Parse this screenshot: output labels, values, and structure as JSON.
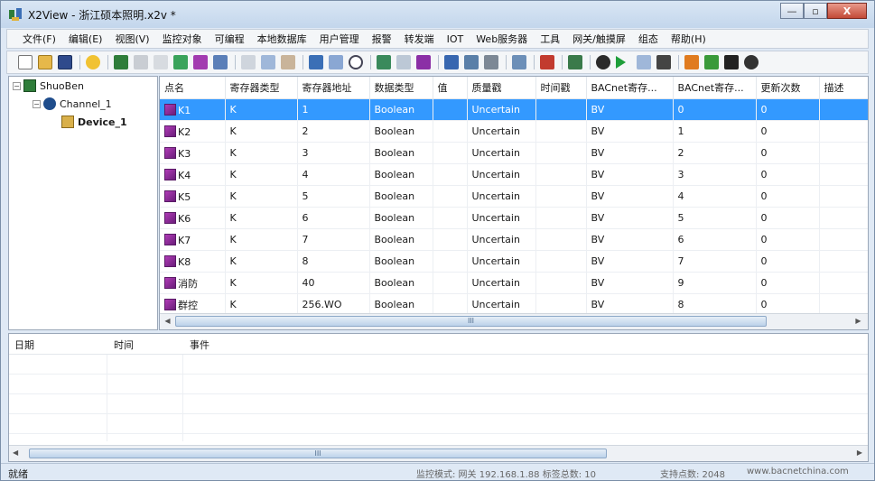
{
  "window": {
    "title": "X2View - 浙江硕本照明.x2v *",
    "min_label": "—",
    "max_label": "▫",
    "close_label": "X"
  },
  "menu": [
    "文件(F)",
    "编辑(E)",
    "视图(V)",
    "监控对象",
    "可编程",
    "本地数据库",
    "用户管理",
    "报警",
    "转发端",
    "IOT",
    "Web服务器",
    "工具",
    "网关/触摸屏",
    "组态",
    "帮助(H)"
  ],
  "tree": {
    "root": "ShuoBen",
    "channel": "Channel_1",
    "device": "Device_1"
  },
  "grid": {
    "columns": [
      "点名",
      "寄存器类型",
      "寄存器地址",
      "数据类型",
      "值",
      "质量戳",
      "时间戳",
      "BACnet寄存...",
      "BACnet寄存...",
      "更新次数",
      "描述"
    ],
    "rows": [
      {
        "name": "K1",
        "reg_type": "K",
        "reg_addr": "1",
        "data_type": "Boolean",
        "value": "",
        "quality": "Uncertain",
        "timestamp": "",
        "bac_type": "BV",
        "bac_addr": "0",
        "updates": "0",
        "desc": ""
      },
      {
        "name": "K2",
        "reg_type": "K",
        "reg_addr": "2",
        "data_type": "Boolean",
        "value": "",
        "quality": "Uncertain",
        "timestamp": "",
        "bac_type": "BV",
        "bac_addr": "1",
        "updates": "0",
        "desc": ""
      },
      {
        "name": "K3",
        "reg_type": "K",
        "reg_addr": "3",
        "data_type": "Boolean",
        "value": "",
        "quality": "Uncertain",
        "timestamp": "",
        "bac_type": "BV",
        "bac_addr": "2",
        "updates": "0",
        "desc": ""
      },
      {
        "name": "K4",
        "reg_type": "K",
        "reg_addr": "4",
        "data_type": "Boolean",
        "value": "",
        "quality": "Uncertain",
        "timestamp": "",
        "bac_type": "BV",
        "bac_addr": "3",
        "updates": "0",
        "desc": ""
      },
      {
        "name": "K5",
        "reg_type": "K",
        "reg_addr": "5",
        "data_type": "Boolean",
        "value": "",
        "quality": "Uncertain",
        "timestamp": "",
        "bac_type": "BV",
        "bac_addr": "4",
        "updates": "0",
        "desc": ""
      },
      {
        "name": "K6",
        "reg_type": "K",
        "reg_addr": "6",
        "data_type": "Boolean",
        "value": "",
        "quality": "Uncertain",
        "timestamp": "",
        "bac_type": "BV",
        "bac_addr": "5",
        "updates": "0",
        "desc": ""
      },
      {
        "name": "K7",
        "reg_type": "K",
        "reg_addr": "7",
        "data_type": "Boolean",
        "value": "",
        "quality": "Uncertain",
        "timestamp": "",
        "bac_type": "BV",
        "bac_addr": "6",
        "updates": "0",
        "desc": ""
      },
      {
        "name": "K8",
        "reg_type": "K",
        "reg_addr": "8",
        "data_type": "Boolean",
        "value": "",
        "quality": "Uncertain",
        "timestamp": "",
        "bac_type": "BV",
        "bac_addr": "7",
        "updates": "0",
        "desc": ""
      },
      {
        "name": "消防",
        "reg_type": "K",
        "reg_addr": "40",
        "data_type": "Boolean",
        "value": "",
        "quality": "Uncertain",
        "timestamp": "",
        "bac_type": "BV",
        "bac_addr": "9",
        "updates": "0",
        "desc": ""
      },
      {
        "name": "群控",
        "reg_type": "K",
        "reg_addr": "256.WO",
        "data_type": "Boolean",
        "value": "",
        "quality": "Uncertain",
        "timestamp": "",
        "bac_type": "BV",
        "bac_addr": "8",
        "updates": "0",
        "desc": ""
      }
    ],
    "selected_index": 0,
    "scroll_mark": "III"
  },
  "log": {
    "columns": [
      "日期",
      "时间",
      "事件"
    ],
    "scroll_mark": "III"
  },
  "status": {
    "ready": "就绪",
    "mode": "监控模式: 网关 192.168.1.88 标签总数: 10",
    "capacity": "支持点数: 2048",
    "website": "www.bacnetchina.com"
  },
  "colors": {
    "selection": "#3399ff",
    "window_bg": "#dfe9f5"
  }
}
